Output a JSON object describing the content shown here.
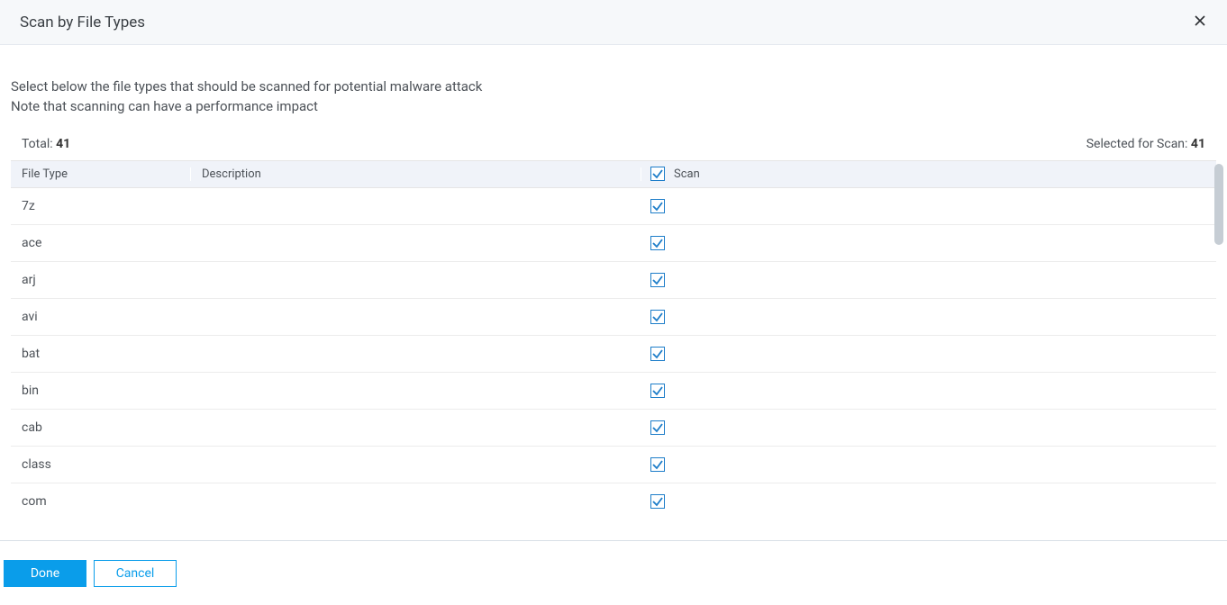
{
  "header": {
    "title": "Scan by File Types"
  },
  "instructions": {
    "line1": "Select below the file types that should be scanned for potential malware attack",
    "line2": "Note that scanning can have a performance impact"
  },
  "counts": {
    "total_label": "Total:",
    "total_value": "41",
    "selected_label": "Selected for Scan:",
    "selected_value": "41"
  },
  "table": {
    "headers": {
      "filetype": "File Type",
      "description": "Description",
      "scan": "Scan"
    },
    "rows": [
      {
        "filetype": "7z",
        "description": "",
        "scan": true
      },
      {
        "filetype": "ace",
        "description": "",
        "scan": true
      },
      {
        "filetype": "arj",
        "description": "",
        "scan": true
      },
      {
        "filetype": "avi",
        "description": "",
        "scan": true
      },
      {
        "filetype": "bat",
        "description": "",
        "scan": true
      },
      {
        "filetype": "bin",
        "description": "",
        "scan": true
      },
      {
        "filetype": "cab",
        "description": "",
        "scan": true
      },
      {
        "filetype": "class",
        "description": "",
        "scan": true
      },
      {
        "filetype": "com",
        "description": "",
        "scan": true
      }
    ]
  },
  "footer": {
    "done": "Done",
    "cancel": "Cancel"
  }
}
